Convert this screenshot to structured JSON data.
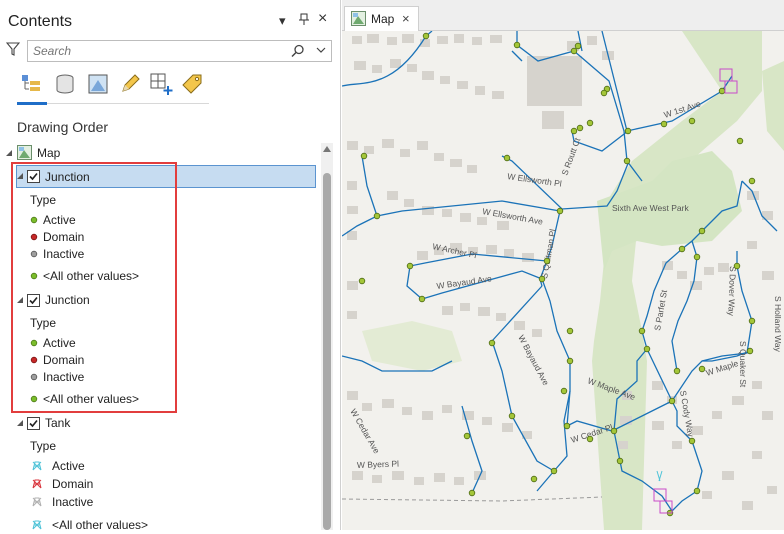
{
  "contents": {
    "title": "Contents",
    "pin": "📌",
    "close": "×",
    "search": {
      "placeholder": "Search"
    },
    "section_title": "Drawing Order",
    "map_node": "Map",
    "layers": [
      {
        "name": "Junction",
        "checked": true,
        "selected": true,
        "type_heading": "Type",
        "values": [
          "Active",
          "Domain",
          "Inactive"
        ],
        "other": "<All other values>"
      },
      {
        "name": "Junction",
        "checked": true,
        "selected": false,
        "type_heading": "Type",
        "values": [
          "Active",
          "Domain",
          "Inactive"
        ],
        "other": "<All other values>"
      },
      {
        "name": "Tank",
        "checked": true,
        "selected": false,
        "type_heading": "Type",
        "values": [
          "Active",
          "Domain",
          "Inactive"
        ],
        "other": "<All other values>"
      }
    ],
    "symbol_colors": {
      "active": "#7bbd2b",
      "domain": "#c62828",
      "inactive": "#9e9e9e",
      "tank_active": "#4fc3d8",
      "tank_domain": "#d9363e",
      "tank_inactive": "#b0b0b0"
    },
    "toolbar_icons": [
      "list-by-drawing-order-icon",
      "list-by-data-source-icon",
      "list-by-selection-icon",
      "list-by-editing-icon",
      "list-by-snapping-icon",
      "list-by-labeling-icon"
    ]
  },
  "map": {
    "tab_label": "Map",
    "tab_close": "×",
    "colors": {
      "background": "#f2f1ed",
      "park": "#d4e5c3",
      "water_main": "#1b73b8",
      "junction": "#a4c639",
      "building": "#d6d3cd"
    },
    "street_labels": [
      "W 1st Ave",
      "W Ellsworth Pl",
      "W Ellsworth Ave",
      "W Archer Pl",
      "W Bayaud Ave",
      "W Bayaud Ave",
      "Sixth Ave West Park",
      "W Maple Ave",
      "W Maple",
      "W Cedar Pl",
      "W Byers Pl",
      "W Cedar Ave",
      "S Dover Way",
      "S Cody Way",
      "S Routt Ct",
      "S Quitman Pl",
      "S Parfet St",
      "S Quaker St",
      "S Holland Way"
    ]
  }
}
